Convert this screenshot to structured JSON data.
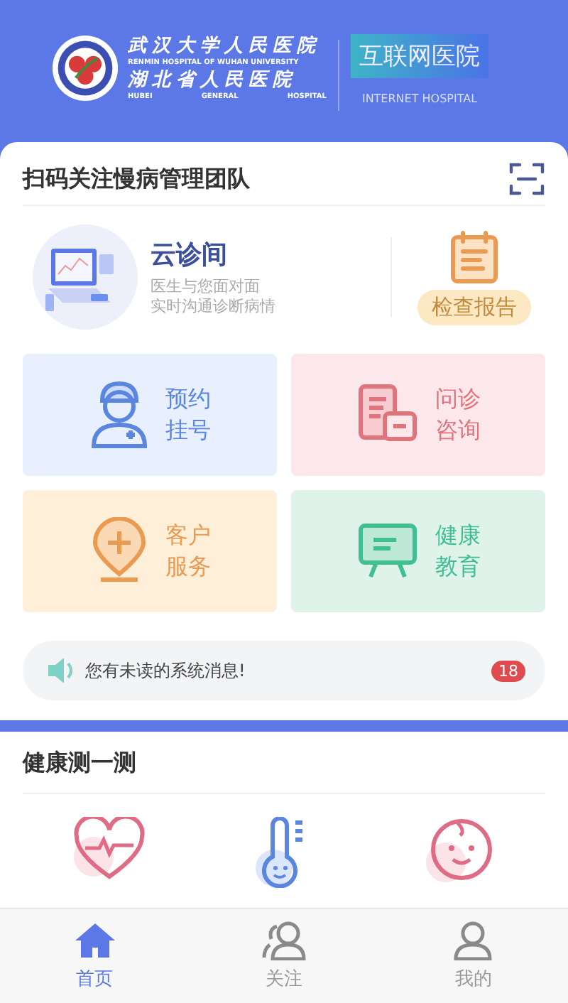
{
  "header": {
    "hospital_cn_1": "武汉大学人民医院",
    "hospital_en_1": "RENMIN HOSPITAL OF WUHAN UNIVERSITY",
    "hospital_cn_2": "湖北省人民医院",
    "hospital_en_2": [
      "HUBEI",
      "GENERAL",
      "HOSPITAL"
    ],
    "badge": "互联网医院",
    "badge_en": "INTERNET HOSPITAL"
  },
  "scan": {
    "title": "扫码关注慢病管理团队"
  },
  "cloud": {
    "title": "云诊间",
    "lines": [
      "医生与您面对面",
      "实时沟通诊断病情"
    ],
    "report": "检查报告"
  },
  "tiles": [
    {
      "kind": "register",
      "lines": [
        "预约",
        "挂号"
      ],
      "color": "#e8f0fd"
    },
    {
      "kind": "consult",
      "lines": [
        "问诊",
        "咨询"
      ],
      "color": "#fce8ea"
    },
    {
      "kind": "service",
      "lines": [
        "客户",
        "服务"
      ],
      "color": "#fdefd8"
    },
    {
      "kind": "education",
      "lines": [
        "健康",
        "教育"
      ],
      "color": "#dff3ea"
    }
  ],
  "notice": {
    "text": "您有未读的系统消息!",
    "count": "18"
  },
  "health": {
    "title": "健康测一测",
    "items": [
      {
        "kind": "heart"
      },
      {
        "kind": "thermo"
      },
      {
        "kind": "baby"
      }
    ]
  },
  "tabs": [
    {
      "kind": "home",
      "label": "首页",
      "selected": true
    },
    {
      "kind": "follow",
      "label": "关注",
      "selected": false
    },
    {
      "kind": "me",
      "label": "我的",
      "selected": false
    }
  ]
}
